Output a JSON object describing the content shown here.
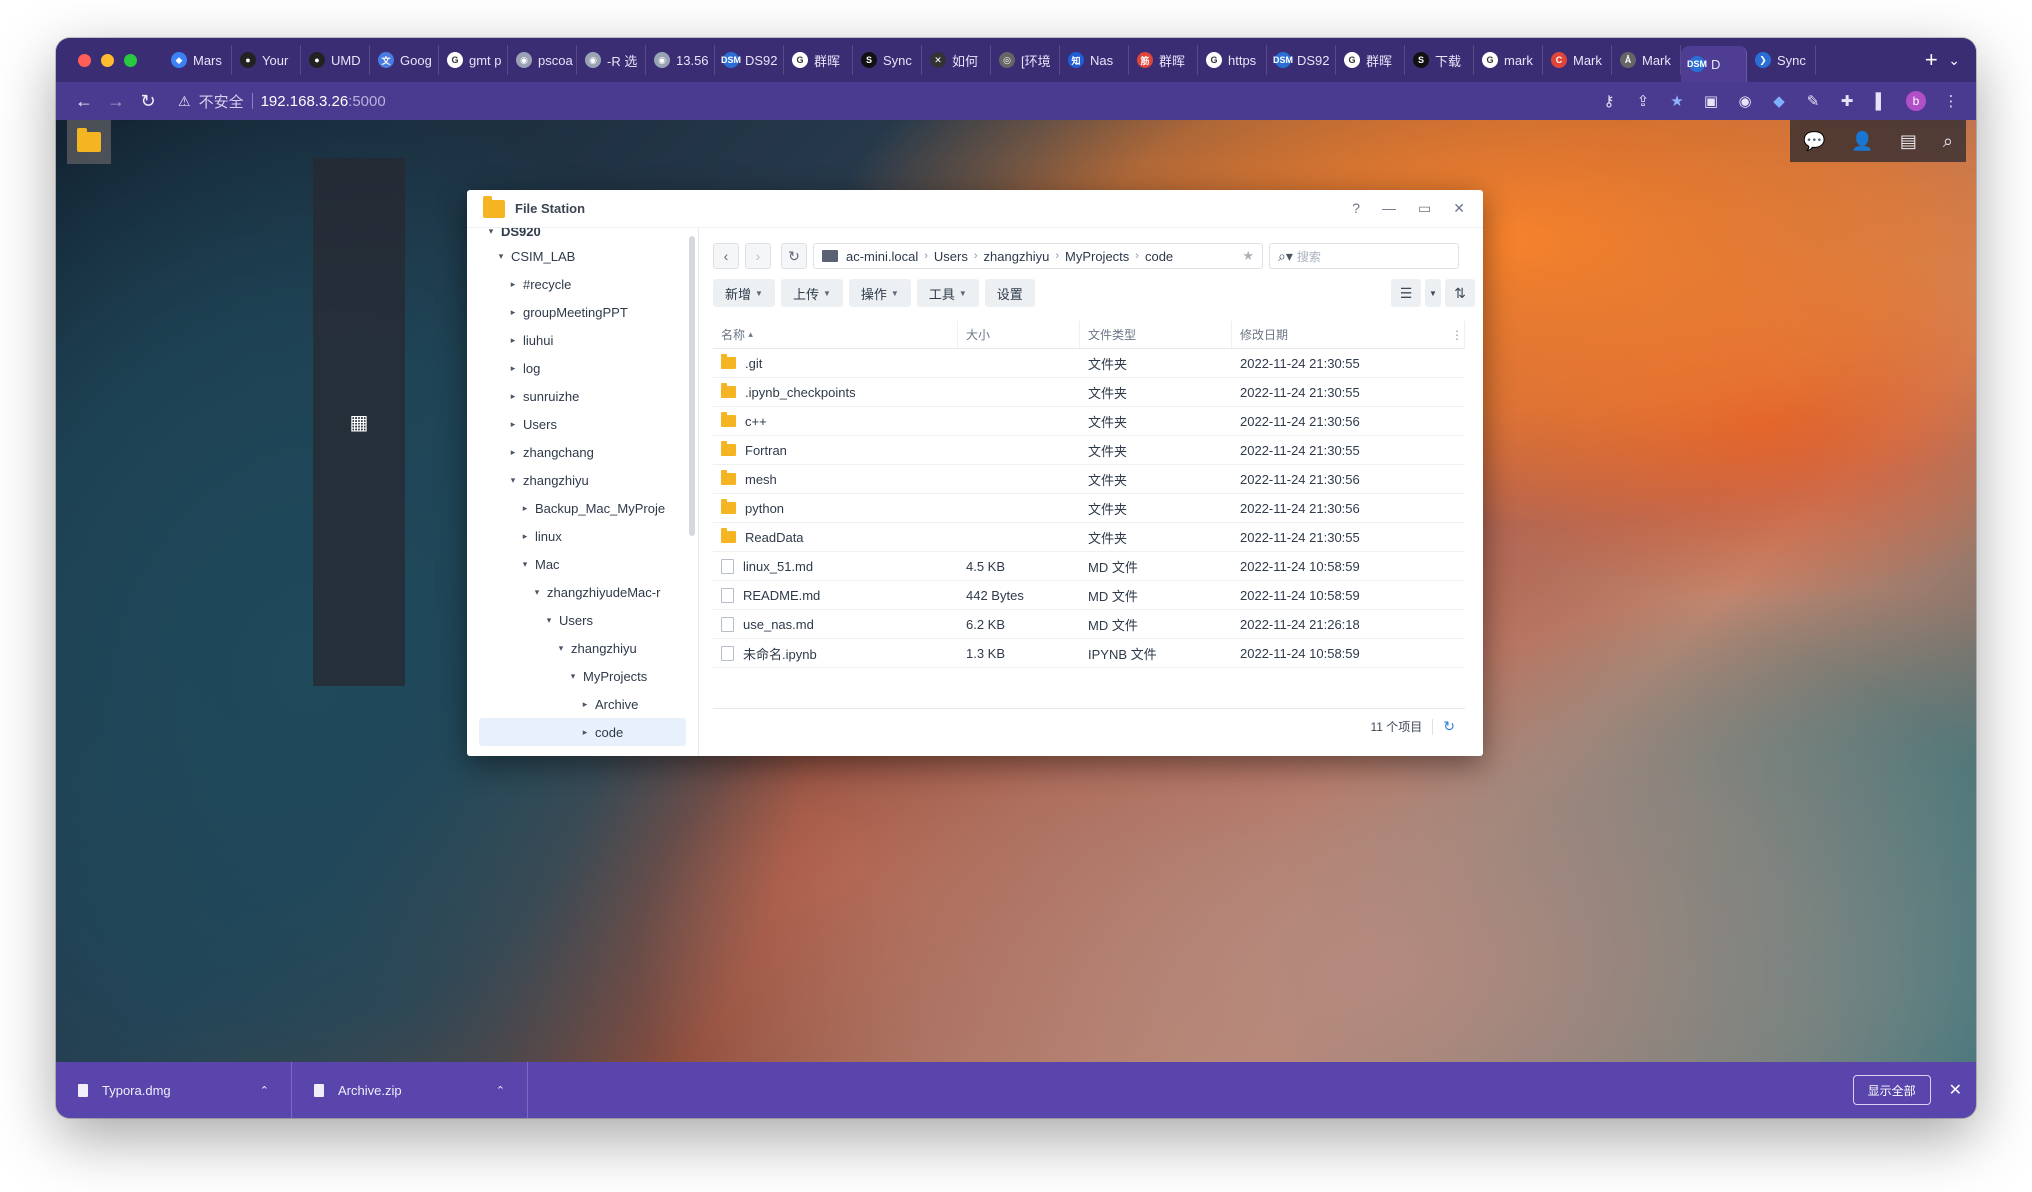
{
  "browser": {
    "tabs": [
      {
        "label": "Mars",
        "fav_color": "#3b82f6",
        "fav": "◆"
      },
      {
        "label": "Your",
        "fav_color": "#222222",
        "fav": "●"
      },
      {
        "label": "UMD",
        "fav_color": "#222222",
        "fav": "●"
      },
      {
        "label": "Goog",
        "fav_color": "#4a7be0",
        "fav": "文"
      },
      {
        "label": "gmt p",
        "fav_color": "#ffffff",
        "fav": "G"
      },
      {
        "label": "pscoa",
        "fav_color": "#9aa3b5",
        "fav": "◉"
      },
      {
        "label": "-R 选",
        "fav_color": "#9aa3b5",
        "fav": "◉"
      },
      {
        "label": "13.56",
        "fav_color": "#9aa3b5",
        "fav": "◉"
      },
      {
        "label": "DS92",
        "fav_color": "#2b6fd6",
        "fav": "DSM"
      },
      {
        "label": "群晖",
        "fav_color": "#ffffff",
        "fav": "G"
      },
      {
        "label": "Sync",
        "fav_color": "#111111",
        "fav": "S"
      },
      {
        "label": "如何",
        "fav_color": "#333333",
        "fav": "✕"
      },
      {
        "label": "[环境",
        "fav_color": "#666666",
        "fav": "◎"
      },
      {
        "label": "Nas",
        "fav_color": "#1e5fd6",
        "fav": "知"
      },
      {
        "label": "群晖",
        "fav_color": "#e0453a",
        "fav": "筋"
      },
      {
        "label": "https",
        "fav_color": "#ffffff",
        "fav": "G"
      },
      {
        "label": "DS92",
        "fav_color": "#2b6fd6",
        "fav": "DSM"
      },
      {
        "label": "群晖",
        "fav_color": "#ffffff",
        "fav": "G"
      },
      {
        "label": "下载",
        "fav_color": "#111111",
        "fav": "S"
      },
      {
        "label": "mark",
        "fav_color": "#ffffff",
        "fav": "G"
      },
      {
        "label": "Mark",
        "fav_color": "#e0453a",
        "fav": "C"
      },
      {
        "label": "Mark",
        "fav_color": "#666666",
        "fav": "Å"
      },
      {
        "label": "D",
        "fav_color": "#2b6fd6",
        "fav": "DSM",
        "active": true
      },
      {
        "label": "Sync",
        "fav_color": "#2b6fd6",
        "fav": "❯"
      }
    ],
    "new_tab": "+",
    "address": {
      "insecure_label": "不安全",
      "host": "192.168.3.26",
      "port": ":5000"
    },
    "avatar_letter": "b"
  },
  "file_station": {
    "title": "File Station",
    "tree": {
      "root": "DS920",
      "items": [
        {
          "label": "CSIM_LAB",
          "depth": 1,
          "open": true
        },
        {
          "label": "#recycle",
          "depth": 2,
          "open": false
        },
        {
          "label": "groupMeetingPPT",
          "depth": 2,
          "open": false
        },
        {
          "label": "liuhui",
          "depth": 2,
          "open": false
        },
        {
          "label": "log",
          "depth": 2,
          "open": false
        },
        {
          "label": "sunruizhe",
          "depth": 2,
          "open": false
        },
        {
          "label": "Users",
          "depth": 2,
          "open": false
        },
        {
          "label": "zhangchang",
          "depth": 2,
          "open": false
        },
        {
          "label": "zhangzhiyu",
          "depth": 2,
          "open": true
        },
        {
          "label": "Backup_Mac_MyProje",
          "depth": 3,
          "open": false
        },
        {
          "label": "linux",
          "depth": 3,
          "open": false
        },
        {
          "label": "Mac",
          "depth": 3,
          "open": true
        },
        {
          "label": "zhangzhiyudeMac-r",
          "depth": 4,
          "open": true
        },
        {
          "label": "Users",
          "depth": 5,
          "open": true
        },
        {
          "label": "zhangzhiyu",
          "depth": 6,
          "open": true
        },
        {
          "label": "MyProjects",
          "depth": 7,
          "open": true
        },
        {
          "label": "Archive",
          "depth": 8,
          "open": false
        },
        {
          "label": "code",
          "depth": 8,
          "open": false,
          "selected": true
        }
      ]
    },
    "path": {
      "crumbs": [
        "ac-mini.local",
        "Users",
        "zhangzhiyu",
        "MyProjects",
        "code"
      ]
    },
    "search_placeholder": "搜索",
    "actions": [
      {
        "label": "新增"
      },
      {
        "label": "上传"
      },
      {
        "label": "操作"
      },
      {
        "label": "工具"
      },
      {
        "label": "设置",
        "no_dropdown": true
      }
    ],
    "columns": {
      "name": "名称",
      "size": "大小",
      "type": "文件类型",
      "date": "修改日期"
    },
    "files": [
      {
        "name": ".git",
        "size": "",
        "type": "文件夹",
        "date": "2022-11-24 21:30:55",
        "kind": "folder"
      },
      {
        "name": ".ipynb_checkpoints",
        "size": "",
        "type": "文件夹",
        "date": "2022-11-24 21:30:55",
        "kind": "folder"
      },
      {
        "name": "c++",
        "size": "",
        "type": "文件夹",
        "date": "2022-11-24 21:30:56",
        "kind": "folder"
      },
      {
        "name": "Fortran",
        "size": "",
        "type": "文件夹",
        "date": "2022-11-24 21:30:55",
        "kind": "folder"
      },
      {
        "name": "mesh",
        "size": "",
        "type": "文件夹",
        "date": "2022-11-24 21:30:56",
        "kind": "folder"
      },
      {
        "name": "python",
        "size": "",
        "type": "文件夹",
        "date": "2022-11-24 21:30:56",
        "kind": "folder"
      },
      {
        "name": "ReadData",
        "size": "",
        "type": "文件夹",
        "date": "2022-11-24 21:30:55",
        "kind": "folder"
      },
      {
        "name": "linux_51.md",
        "size": "4.5 KB",
        "type": "MD 文件",
        "date": "2022-11-24 10:58:59",
        "kind": "file"
      },
      {
        "name": "README.md",
        "size": "442 Bytes",
        "type": "MD 文件",
        "date": "2022-11-24 10:58:59",
        "kind": "file"
      },
      {
        "name": "use_nas.md",
        "size": "6.2 KB",
        "type": "MD 文件",
        "date": "2022-11-24 21:26:18",
        "kind": "file"
      },
      {
        "name": "未命名.ipynb",
        "size": "1.3 KB",
        "type": "IPYNB 文件",
        "date": "2022-11-24 10:58:59",
        "kind": "file"
      }
    ],
    "item_count": "11 个项目"
  },
  "downloads": {
    "items": [
      {
        "name": "Typora.dmg"
      },
      {
        "name": "Archive.zip"
      }
    ],
    "show_all": "显示全部"
  }
}
